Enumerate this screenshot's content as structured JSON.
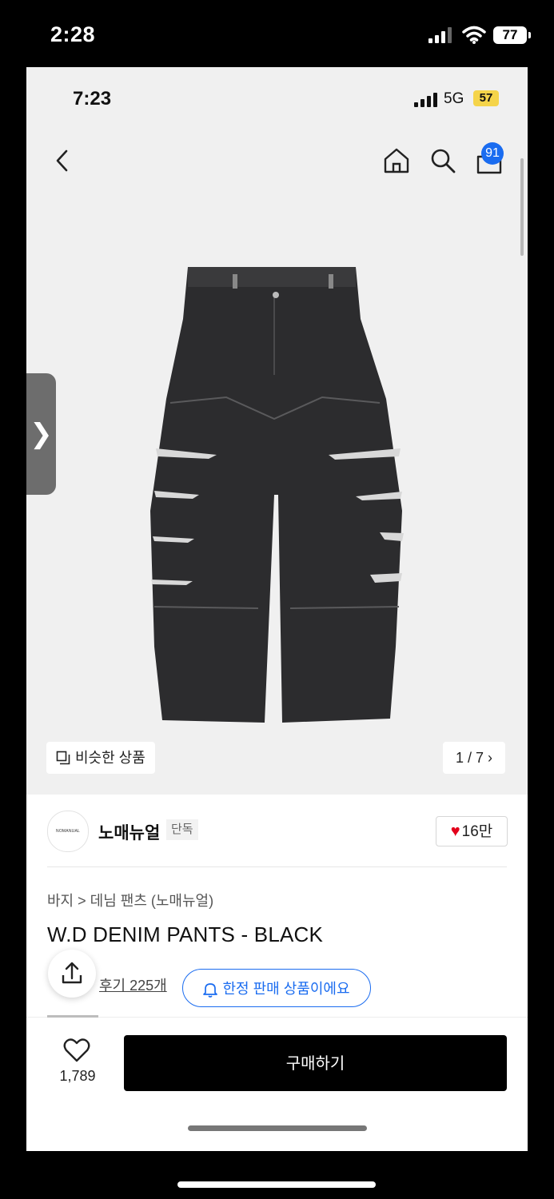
{
  "outer_status": {
    "time": "2:28",
    "battery": "77"
  },
  "inner_status": {
    "time": "7:23",
    "network": "5G",
    "battery": "57"
  },
  "header": {
    "back_icon": "chevron-left-icon",
    "home_icon": "home-icon",
    "search_icon": "search-icon",
    "cart_icon": "shopping-bag-icon",
    "cart_badge": "91"
  },
  "gallery": {
    "side_tab_glyph": "❯",
    "similar_label": "비슷한 상품",
    "counter": "1 / 7 ›"
  },
  "brand": {
    "logo_text": "NOMANUAL",
    "name": "노매뉴얼",
    "tag": "단독",
    "likes": "16만"
  },
  "product": {
    "breadcrumb": "바지 > 데님 팬츠 (노매뉴얼)",
    "title": "W.D DENIM PANTS - BLACK",
    "review_link": "후기 225개",
    "limited_label": "한정 판매 상품이에요"
  },
  "bottom_bar": {
    "wish_count": "1,789",
    "buy_label": "구매하기"
  },
  "colors": {
    "accent": "#1a6cf0",
    "buy_button": "#000000",
    "heart": "#e3001b"
  }
}
